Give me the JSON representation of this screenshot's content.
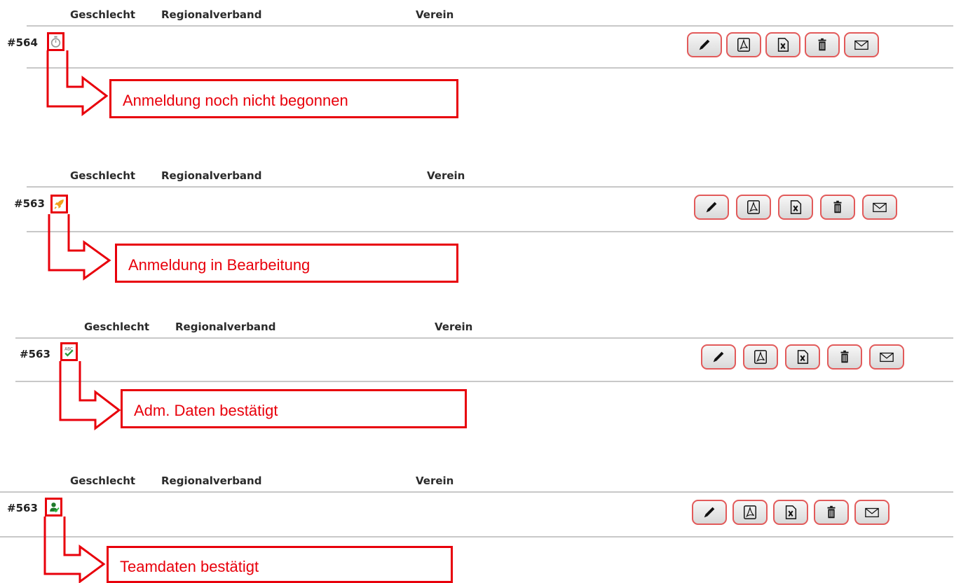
{
  "columns": {
    "gender": "Geschlecht",
    "region": "Regionalverband",
    "club": "Verein"
  },
  "accent_color": "#e8000b",
  "buttons": [
    {
      "name": "edit-button",
      "icon": "pencil-icon"
    },
    {
      "name": "pdf-button",
      "icon": "pdf-icon"
    },
    {
      "name": "excel-button",
      "icon": "excel-icon"
    },
    {
      "name": "delete-button",
      "icon": "trash-icon"
    },
    {
      "name": "mail-button",
      "icon": "envelope-icon"
    }
  ],
  "sections": [
    {
      "id": "#564",
      "status_icon": "stopwatch-icon",
      "callout": "Anmeldung noch nicht begonnen"
    },
    {
      "id": "#563",
      "status_icon": "rocket-icon",
      "callout": "Anmeldung in Bearbeitung"
    },
    {
      "id": "#563",
      "status_icon": "spellcheck-icon",
      "callout": "Adm. Daten bestätigt"
    },
    {
      "id": "#563",
      "status_icon": "team-user-icon",
      "callout": "Teamdaten bestätigt"
    }
  ]
}
